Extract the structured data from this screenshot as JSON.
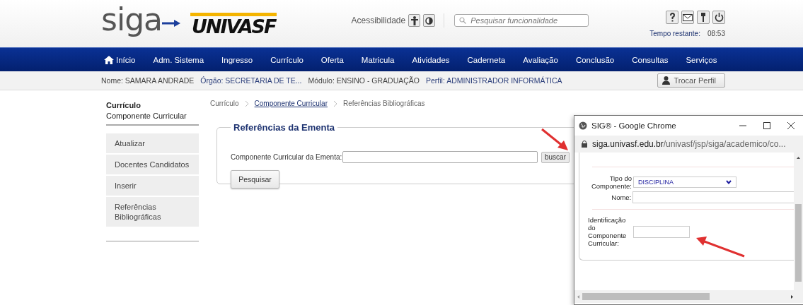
{
  "header": {
    "logo_primary": "siga",
    "logo_secondary": "UNIVASF",
    "accessibility_label": "Acessibilidade",
    "search": {
      "placeholder": "Pesquisar funcionalidade"
    },
    "time_label": "Tempo restante:",
    "time_value": "08:53"
  },
  "nav": {
    "items": [
      {
        "label": "Início",
        "kind": "home"
      },
      {
        "label": "Adm. Sistema",
        "kind": "plain"
      },
      {
        "label": "Ingresso",
        "kind": "plain"
      },
      {
        "label": "Currículo",
        "kind": "plain"
      },
      {
        "label": "Oferta",
        "kind": "plain"
      },
      {
        "label": "Matricula",
        "kind": "plain"
      },
      {
        "label": "Atividades",
        "kind": "plain"
      },
      {
        "label": "Caderneta",
        "kind": "plain"
      },
      {
        "label": "Avaliação",
        "kind": "plain"
      },
      {
        "label": "Conclusão",
        "kind": "plain"
      },
      {
        "label": "Consultas",
        "kind": "plain"
      },
      {
        "label": "Serviços",
        "kind": "plain"
      }
    ]
  },
  "user_bar": {
    "fields": [
      "Nome: SAMARA ANDRADE",
      "Órgão: SECRETARIA DE TE...",
      "Módulo: ENSINO - GRADUAÇÃO",
      "Perfil: ADMINISTRADOR INFORMÁTICA"
    ],
    "button": "Trocar Perfil"
  },
  "sidebar": {
    "title": "Currículo",
    "subtitle": "Componente Curricular",
    "items": [
      "Atualizar",
      "Docentes Candidatos",
      "Inserir",
      "Referências Bibliográficas"
    ]
  },
  "breadcrumb": [
    {
      "label": "Currículo",
      "link": false
    },
    {
      "label": "Componente Curricular",
      "link": true
    },
    {
      "label": "Referências Bibliográficas",
      "link": false
    }
  ],
  "form": {
    "legend": "Referências da Ementa",
    "field_label": "Componente Curricular da Ementa:",
    "lookup_button": "buscar",
    "submit_button": "Pesquisar"
  },
  "popup": {
    "title": "SIG® - Google Chrome",
    "url_host": "siga.univasf.edu.br",
    "url_path": "/univasf/jsp/siga/academico/co...",
    "type_label": "Tipo do Componente:",
    "type_value": "DISCIPLINA",
    "name_label": "Nome:",
    "id_label": "Identificação do Componente Curricular:"
  }
}
